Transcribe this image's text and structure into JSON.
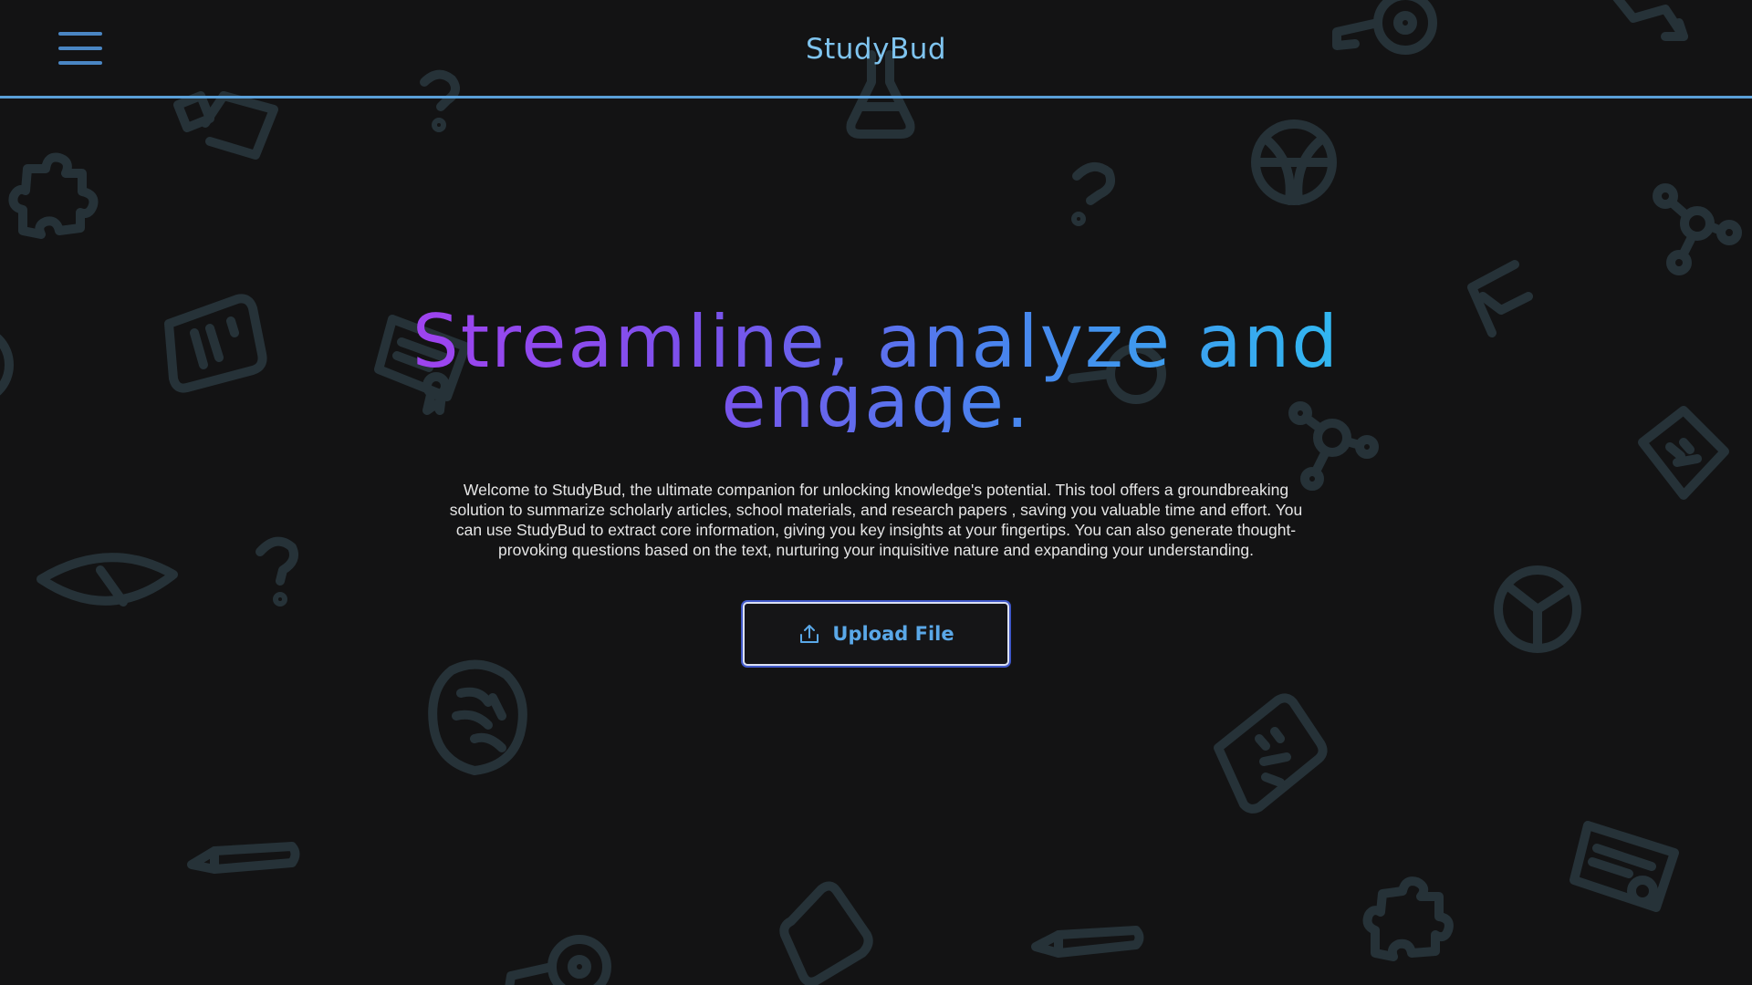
{
  "header": {
    "menu_icon": "hamburger-menu-icon",
    "title": "StudyBud"
  },
  "hero": {
    "title": "Streamline, analyze and engage.",
    "description": "Welcome to StudyBud, the ultimate companion for unlocking knowledge's potential. This tool offers a groundbreaking solution to summarize scholarly articles, school materials, and research papers , saving you valuable time and effort. You can use StudyBud to extract core information, giving you key insights at your fingertips. You can also generate thought-provoking questions based on the text, nurturing your inquisitive nature and expanding your understanding.",
    "gradient_colors": [
      "#a93ff0",
      "#7a52ec",
      "#4a82ee",
      "#2bc4f0"
    ]
  },
  "upload": {
    "label": "Upload File",
    "icon": "upload-icon"
  },
  "colors": {
    "background": "#131314",
    "header_border": "#5a9fd8",
    "title": "#7fc4ef",
    "menu_icon": "#4a86c4",
    "button_text": "#5aa8e8",
    "doodle_stroke": "#263238"
  },
  "background_doodles": [
    "key-icon",
    "chat-icon",
    "question-mark-icon",
    "flask-icon",
    "books-icon",
    "globe-icon",
    "puzzle-piece-icon",
    "molecule-icon",
    "note-icon",
    "certificate-icon",
    "pencil-icon",
    "eye-icon",
    "brain-icon",
    "peace-icon",
    "graduation-cap-icon",
    "graph-icon"
  ]
}
